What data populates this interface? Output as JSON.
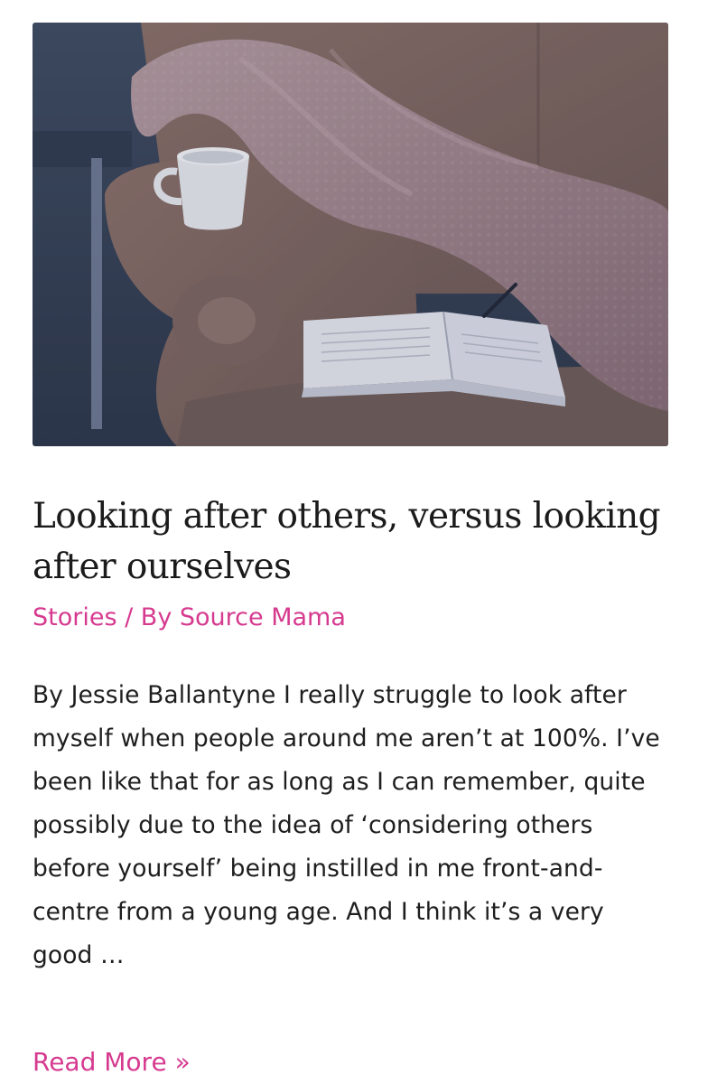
{
  "post": {
    "image_alt": "Couch with blanket, mug and open book",
    "title": "Looking after others, versus looking after ourselves",
    "category": "Stories",
    "separator": " / By ",
    "author": "Source Mama",
    "excerpt": "By Jessie Ballantyne I really struggle to look after myself when people around me aren’t at 100%. I’ve been like that for as long as I can remember, quite possibly due to the idea of ‘considering others before yourself’ being instilled in me front-and-centre from a young age. And I think it’s a very good …",
    "read_more": "Read More »"
  },
  "colors": {
    "accent": "#d63a8f",
    "text": "#1e1e1e",
    "title": "#1b1b1b"
  }
}
